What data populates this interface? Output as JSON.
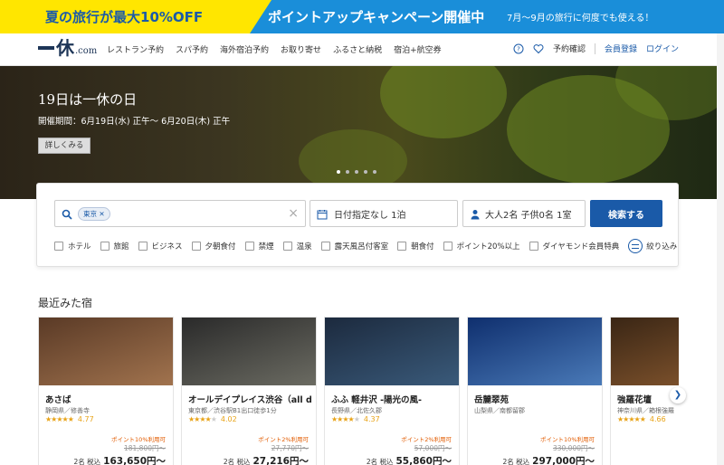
{
  "promo": {
    "main": "夏の旅行が最大10%OFF",
    "campaign": "ポイントアップキャンペーン開催中",
    "note": "7月〜9月の旅行に何度でも使える！"
  },
  "header": {
    "logo_kanji": "休",
    "logo_domain": ".com",
    "nav": [
      "レストラン予約",
      "スパ予約",
      "海外宿泊予約",
      "お取り寄せ",
      "ふるさと納税",
      "宿泊+航空券"
    ],
    "reservation": "予約確認",
    "register": "会員登録",
    "login": "ログイン"
  },
  "hero": {
    "title": "19日は一休の日",
    "period": "開催期間：6月19日(水) 正午〜 6月20日(木) 正午",
    "details": "詳しくみる",
    "slide_count": 5,
    "active_slide": 1
  },
  "search": {
    "area_chip": "東京",
    "date": "日付指定なし 1泊",
    "people": "大人2名 子供0名 1室",
    "button": "検索する",
    "filters": [
      "ホテル",
      "旅館",
      "ビジネス",
      "夕朝食付",
      "禁煙",
      "温泉",
      "露天風呂付客室",
      "朝食付",
      "ポイント20%以上",
      "ダイヤモンド会員特典"
    ],
    "narrow": "絞り込み"
  },
  "recent": {
    "title": "最近みた宿",
    "cards": [
      {
        "name": "あさば",
        "loc": "静岡県／修善寺",
        "rating": "4.77",
        "stars": 4.5,
        "pt": "ポイント10%利用可",
        "old": "181,800円〜",
        "price_label": "2名 税込",
        "price": "163,650円〜",
        "colors": [
          "#5a3a26",
          "#a1734e"
        ]
      },
      {
        "name": "オールデイプレイス渋谷（all d…",
        "loc": "東京都／渋谷駅B1出口徒歩1分",
        "rating": "4.02",
        "stars": 4,
        "pt": "ポイント2%利用可",
        "old": "27,770円〜",
        "price_label": "2名 税込",
        "price": "27,216円〜",
        "colors": [
          "#2a2a2a",
          "#6b6b62"
        ]
      },
      {
        "name": "ふふ 軽井沢 -陽光の風-",
        "loc": "長野県／北佐久郡",
        "rating": "4.37",
        "stars": 4,
        "pt": "ポイント2%利用可",
        "old": "57,000円〜",
        "price_label": "2名 税込",
        "price": "55,860円〜",
        "colors": [
          "#1c2a3e",
          "#3a5a7a"
        ]
      },
      {
        "name": "岳麓翠苑",
        "loc": "山梨県／南都留郡",
        "rating": "",
        "stars": 0,
        "pt": "ポイント10%利用可",
        "old": "330,000円〜",
        "price_label": "2名 税込",
        "price": "297,000円〜",
        "colors": [
          "#0f2f6e",
          "#4a7ab8"
        ]
      },
      {
        "name": "強羅花壇",
        "loc": "神奈川県／箱根強羅",
        "rating": "4.66",
        "stars": 4.5,
        "pt": "",
        "old": "",
        "price_label": "",
        "price": "",
        "colors": [
          "#3a2615",
          "#8a5a30"
        ]
      }
    ]
  }
}
